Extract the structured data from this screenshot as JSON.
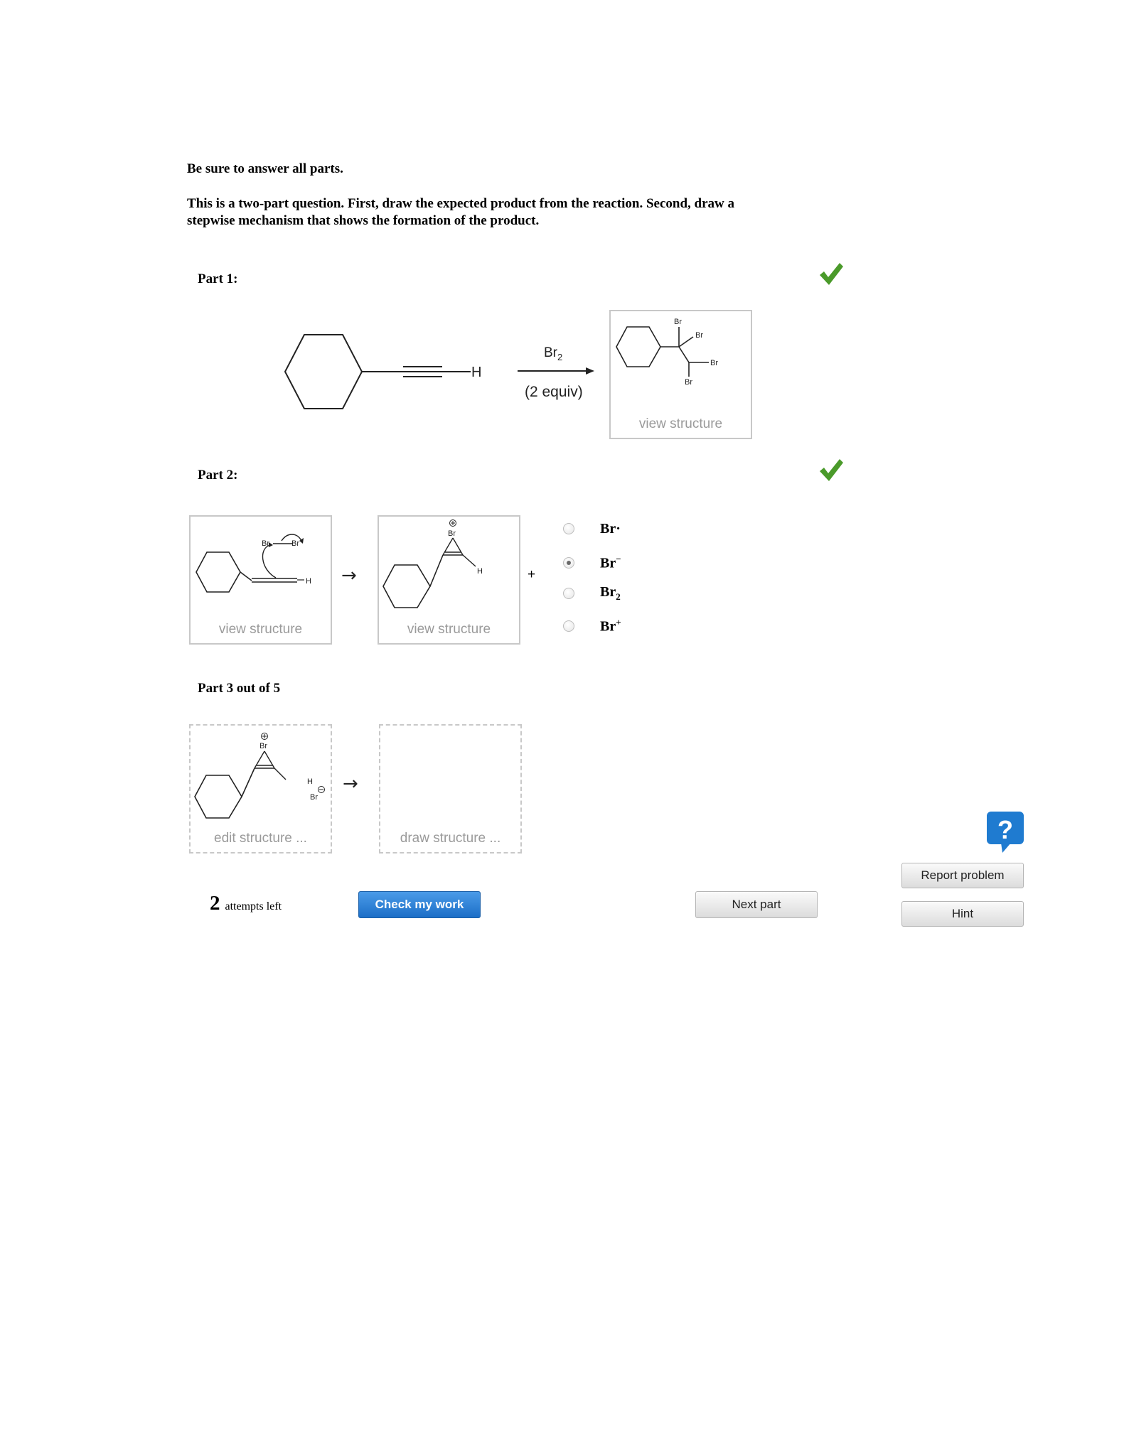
{
  "intro": {
    "line1": "Be sure to answer all parts.",
    "line2": "This is a two-part question. First, draw the expected product from the reaction. Second, draw a",
    "line3": "stepwise mechanism that shows the formation of the product."
  },
  "part1": {
    "label": "Part 1:",
    "status_icon": "green-check",
    "reactant_atom": "H",
    "reagent": "Br",
    "reagent_sub": "2",
    "conditions": "(2 equiv)",
    "product_atoms": [
      "Br",
      "Br",
      "Br",
      "Br"
    ],
    "product_caption": "view structure"
  },
  "part2": {
    "label": "Part 2:",
    "status_icon": "green-check",
    "box1_atoms": [
      "Br",
      "Br",
      "H"
    ],
    "box1_caption": "view structure",
    "box2_atoms": [
      "Br",
      "H"
    ],
    "box2_caption": "view structure",
    "plus": "+",
    "arrow": "→",
    "options": [
      {
        "label": "Br·",
        "selected": false
      },
      {
        "label": "Br",
        "sup": "−",
        "selected": true
      },
      {
        "label": "Br",
        "sub": "2",
        "selected": false
      },
      {
        "label": "Br",
        "sup": "+",
        "selected": false
      }
    ]
  },
  "part3": {
    "label": "Part 3 out of 5",
    "box1_atoms": [
      "Br",
      "H",
      "Br"
    ],
    "box1_caption": "edit structure ...",
    "box2_caption": "draw structure ...",
    "arrow": "→"
  },
  "footer": {
    "attempts_count": "2",
    "attempts_text": "attempts left",
    "check_button": "Check my work",
    "next_button": "Next part",
    "help_icon": "?",
    "report_button": "Report problem",
    "hint_button": "Hint"
  },
  "colors": {
    "check_green": "#4a9a2a",
    "primary_blue": "#1c6ec7",
    "help_blue": "#1f7bd0"
  }
}
